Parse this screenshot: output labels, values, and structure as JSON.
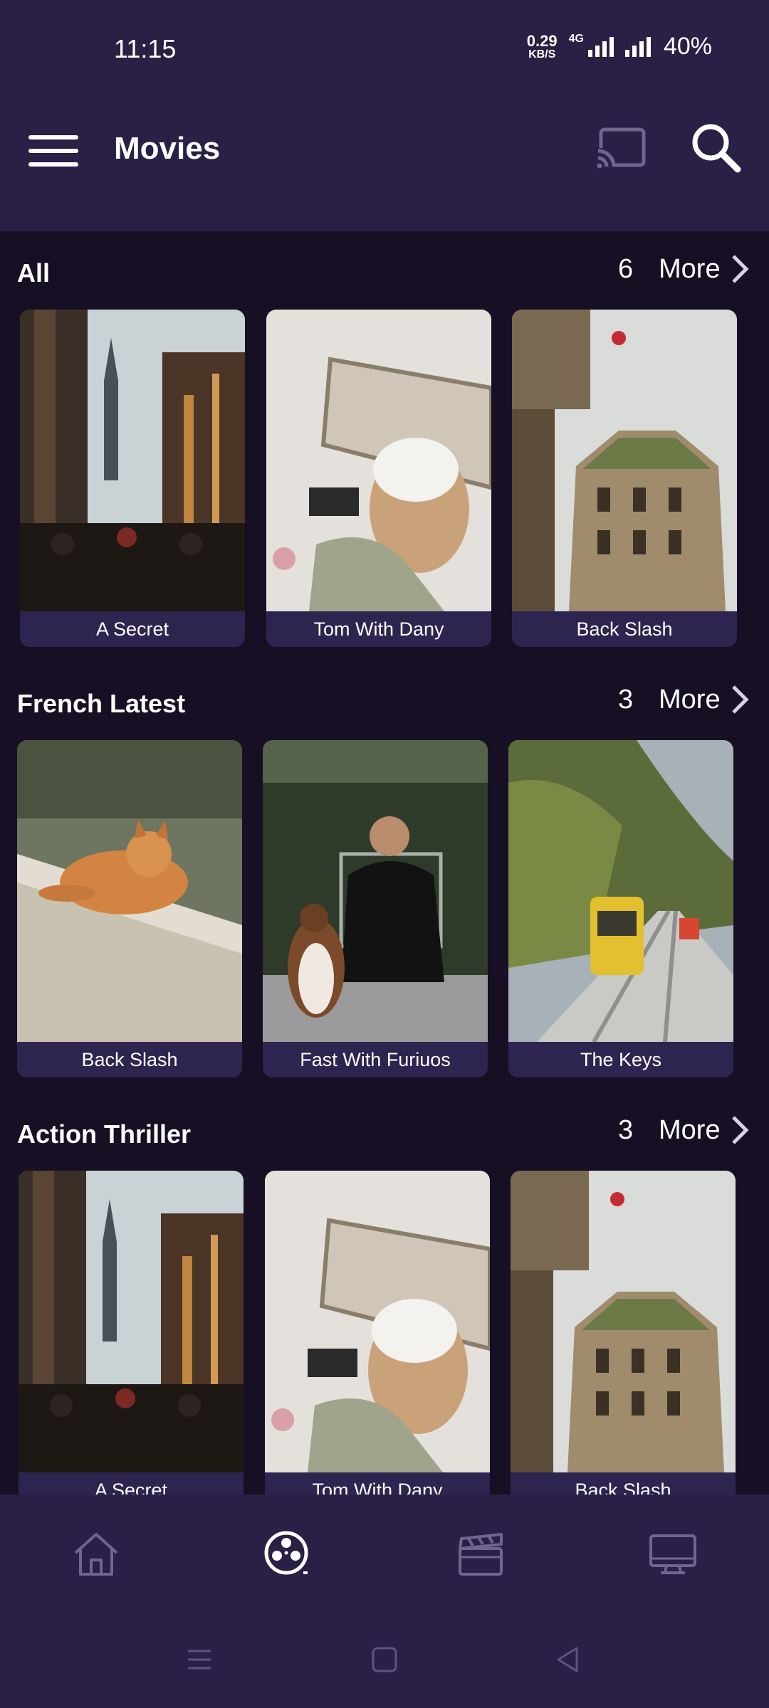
{
  "status_bar": {
    "time": "11:15",
    "net_speed_value": "0.29",
    "net_speed_unit": "KB/S",
    "network_type": "4G",
    "battery": "40%"
  },
  "app_bar": {
    "title": "Movies",
    "menu_icon": "hamburger-menu-icon",
    "cast_icon": "cast-icon",
    "search_icon": "search-icon"
  },
  "sections": [
    {
      "title": "All",
      "count": "6",
      "more_label": "More",
      "items": [
        {
          "title": "A Secret",
          "image": "city-street-tower"
        },
        {
          "title": "Tom With Dany",
          "image": "person-with-cap"
        },
        {
          "title": "Back Slash",
          "image": "ornate-building"
        }
      ]
    },
    {
      "title": "French Latest",
      "count": "3",
      "more_label": "More",
      "items": [
        {
          "title": "Back Slash",
          "image": "orange-cat"
        },
        {
          "title": "Fast With Furiuos",
          "image": "man-and-dog"
        },
        {
          "title": "The Keys",
          "image": "yellow-tram"
        }
      ]
    },
    {
      "title": "Action Thriller",
      "count": "3",
      "more_label": "More",
      "items": [
        {
          "title": "A Secret",
          "image": "city-street-tower"
        },
        {
          "title": "Tom With Dany",
          "image": "person-with-cap"
        },
        {
          "title": "Back Slash",
          "image": "ornate-building"
        }
      ]
    }
  ],
  "bottom_nav": [
    {
      "name": "home",
      "icon": "home-icon",
      "active": false
    },
    {
      "name": "movies",
      "icon": "film-reel-icon",
      "active": true
    },
    {
      "name": "clapperboard",
      "icon": "clapperboard-icon",
      "active": false
    },
    {
      "name": "tv",
      "icon": "tv-icon",
      "active": false
    }
  ],
  "colors": {
    "background": "#170f24",
    "bar": "#2a1f45",
    "card_label_bg": "#2e2450",
    "text": "#ffffff",
    "inactive_icon": "#6f6690"
  }
}
